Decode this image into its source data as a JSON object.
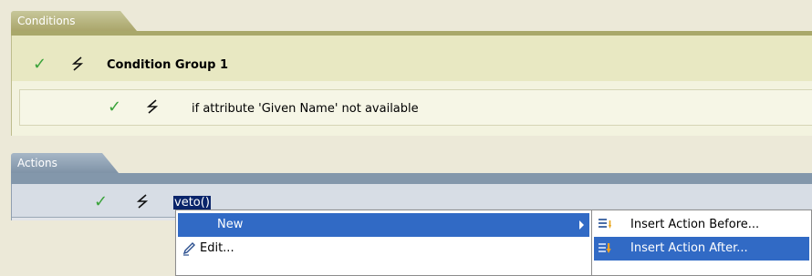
{
  "conditions": {
    "tab_label": "Conditions",
    "group_label": "Condition Group 1",
    "condition_label": "if attribute 'Given Name' not available"
  },
  "actions": {
    "tab_label": "Actions",
    "action_label": "veto()"
  },
  "context_menu": {
    "items": [
      {
        "label": "New",
        "selected": true,
        "has_submenu": true
      },
      {
        "label": "Edit...",
        "icon": "pencil-icon"
      }
    ]
  },
  "submenu": {
    "items": [
      {
        "label": "Insert Action Before...",
        "icon": "insert-before-icon"
      },
      {
        "label": "Insert Action After...",
        "icon": "insert-after-icon",
        "selected": true
      }
    ]
  },
  "colors": {
    "selection": "#316ac5",
    "check": "#3aa33a"
  }
}
